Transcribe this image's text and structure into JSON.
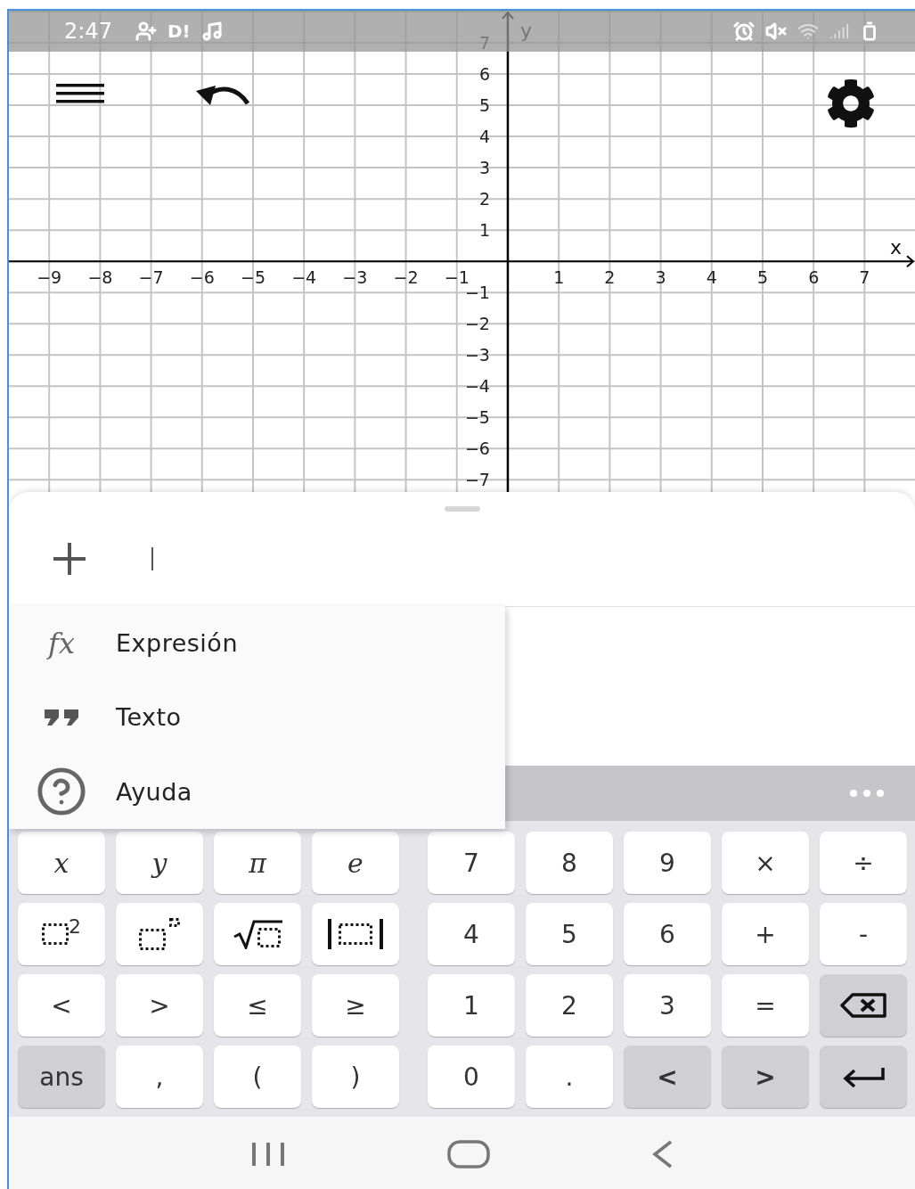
{
  "status_bar": {
    "time": "2:47",
    "notification_text": "D!"
  },
  "graph": {
    "chart_data": {
      "type": "scatter",
      "xlabel": "x",
      "ylabel": "y",
      "xlim": [
        -9.79,
        7.99
      ],
      "ylim": [
        -7.45,
        8.03
      ],
      "grid": true,
      "xticks": [
        {
          "value": -9,
          "label": "−9"
        },
        {
          "value": -8,
          "label": "−8"
        },
        {
          "value": -7,
          "label": "−7"
        },
        {
          "value": -6,
          "label": "−6"
        },
        {
          "value": -5,
          "label": "−5"
        },
        {
          "value": -4,
          "label": "−4"
        },
        {
          "value": -3,
          "label": "−3"
        },
        {
          "value": -2,
          "label": "−2"
        },
        {
          "value": -1,
          "label": "−1"
        },
        {
          "value": 1,
          "label": "1"
        },
        {
          "value": 2,
          "label": "2"
        },
        {
          "value": 3,
          "label": "3"
        },
        {
          "value": 4,
          "label": "4"
        },
        {
          "value": 5,
          "label": "5"
        },
        {
          "value": 6,
          "label": "6"
        },
        {
          "value": 7,
          "label": "7"
        }
      ],
      "yticks": [
        {
          "value": 7,
          "label": "7"
        },
        {
          "value": 6,
          "label": "6"
        },
        {
          "value": 5,
          "label": "5"
        },
        {
          "value": 4,
          "label": "4"
        },
        {
          "value": 3,
          "label": "3"
        },
        {
          "value": 2,
          "label": "2"
        },
        {
          "value": 1,
          "label": "1"
        },
        {
          "value": -1,
          "label": "−1"
        },
        {
          "value": -2,
          "label": "−2"
        },
        {
          "value": -3,
          "label": "−3"
        },
        {
          "value": -4,
          "label": "−4"
        },
        {
          "value": -5,
          "label": "−5"
        },
        {
          "value": -6,
          "label": "−6"
        },
        {
          "value": -7,
          "label": "−7"
        }
      ]
    }
  },
  "menu": {
    "items": [
      {
        "kind": "expression",
        "symbol": "fx",
        "label": "Expresión"
      },
      {
        "kind": "text",
        "label": "Texto"
      },
      {
        "kind": "help",
        "label": "Ayuda"
      }
    ]
  },
  "keyboard": {
    "rows": [
      [
        {
          "kind": "italic",
          "label": "x",
          "secondary": false
        },
        {
          "kind": "italic",
          "label": "y",
          "secondary": false
        },
        {
          "kind": "italic",
          "label": "π",
          "secondary": false
        },
        {
          "kind": "italic",
          "label": "e",
          "secondary": false
        },
        {
          "kind": "text",
          "label": "7",
          "secondary": false
        },
        {
          "kind": "text",
          "label": "8",
          "secondary": false
        },
        {
          "kind": "text",
          "label": "9",
          "secondary": false
        },
        {
          "kind": "text",
          "label": "×",
          "secondary": false
        },
        {
          "kind": "text",
          "label": "÷",
          "secondary": false
        }
      ],
      [
        {
          "kind": "square",
          "label": "2",
          "secondary": false
        },
        {
          "kind": "power",
          "secondary": false
        },
        {
          "kind": "sqrt",
          "secondary": false
        },
        {
          "kind": "abs",
          "secondary": false
        },
        {
          "kind": "text",
          "label": "4",
          "secondary": false
        },
        {
          "kind": "text",
          "label": "5",
          "secondary": false
        },
        {
          "kind": "text",
          "label": "6",
          "secondary": false
        },
        {
          "kind": "text",
          "label": "+",
          "secondary": false
        },
        {
          "kind": "text",
          "label": "-",
          "secondary": false
        }
      ],
      [
        {
          "kind": "text",
          "label": "<",
          "secondary": false
        },
        {
          "kind": "text",
          "label": ">",
          "secondary": false
        },
        {
          "kind": "text",
          "label": "≤",
          "secondary": false
        },
        {
          "kind": "text",
          "label": "≥",
          "secondary": false
        },
        {
          "kind": "text",
          "label": "1",
          "secondary": false
        },
        {
          "kind": "text",
          "label": "2",
          "secondary": false
        },
        {
          "kind": "text",
          "label": "3",
          "secondary": false
        },
        {
          "kind": "text",
          "label": "=",
          "secondary": false
        },
        {
          "kind": "backspace",
          "secondary": true
        }
      ],
      [
        {
          "kind": "text",
          "label": "ans",
          "secondary": true
        },
        {
          "kind": "text",
          "label": ",",
          "secondary": false
        },
        {
          "kind": "text",
          "label": "(",
          "secondary": false
        },
        {
          "kind": "text",
          "label": ")",
          "secondary": false
        },
        {
          "kind": "text",
          "label": "0",
          "secondary": false
        },
        {
          "kind": "text",
          "label": ".",
          "secondary": false
        },
        {
          "kind": "bold",
          "label": "<",
          "secondary": true
        },
        {
          "kind": "bold",
          "label": ">",
          "secondary": true
        },
        {
          "kind": "enter",
          "secondary": true
        }
      ]
    ]
  }
}
